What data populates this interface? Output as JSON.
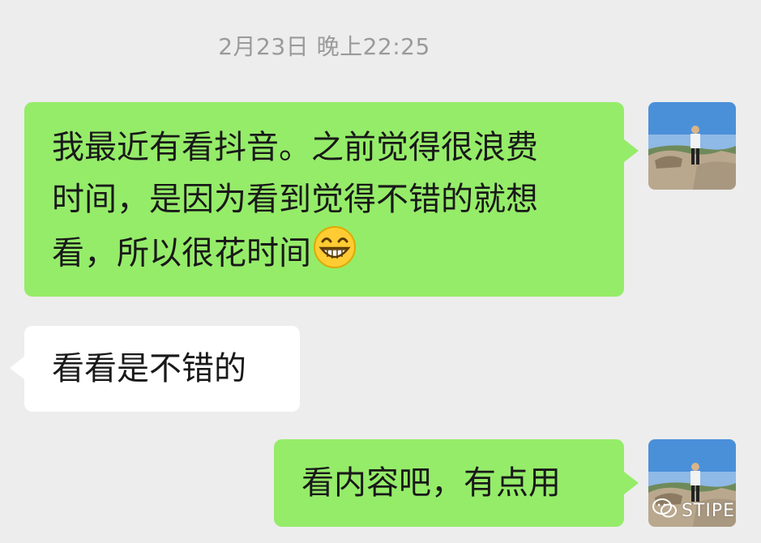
{
  "chat": {
    "timestamp": "2月23日 晚上22:25",
    "messages": [
      {
        "side": "right",
        "lines": [
          "我最近有看抖音。之前觉得很浪费",
          "时间，是因为看到觉得不错的就想",
          "看，所以很花时间"
        ],
        "emoji": "grinning-face"
      },
      {
        "side": "left",
        "lines": [
          "看看是不错的"
        ]
      },
      {
        "side": "right",
        "lines": [
          "看内容吧，有点用"
        ]
      }
    ]
  },
  "watermark": {
    "text": "STIPE",
    "icon": "wechat-icon"
  },
  "colors": {
    "background": "#ededed",
    "bubble_self": "#95ec69",
    "bubble_other": "#ffffff",
    "timestamp": "#9a9a9a"
  }
}
